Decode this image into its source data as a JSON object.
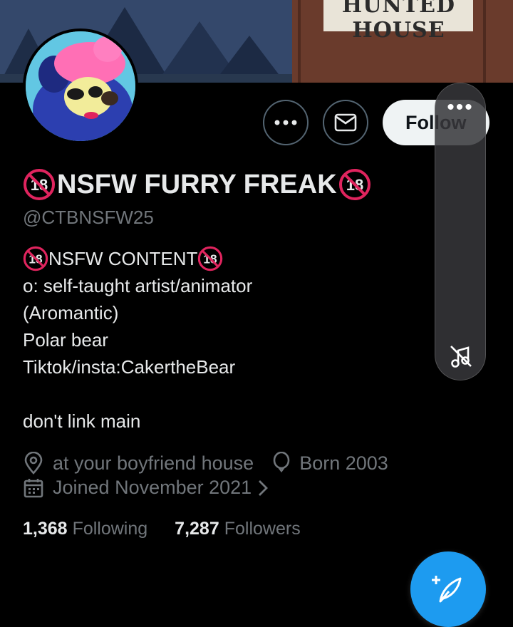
{
  "banner": {
    "sign_text": "HUNTED HOUSE"
  },
  "profile": {
    "display_name": "NSFW FURRY FREAK",
    "handle": "@CTBNSFW25",
    "follow_label": "Follow"
  },
  "bio": {
    "line1": "NSFW CONTENT",
    "line2": "o: self-taught artist/animator",
    "line3": "(Aromantic)",
    "line4": "Polar bear",
    "line5": "Tiktok/insta:CakertheBear",
    "line6": "don't link main"
  },
  "meta": {
    "location": "at your boyfriend house",
    "birthday": "Born 2003",
    "joined": "Joined November 2021"
  },
  "stats": {
    "following_count": "1,368",
    "following_label": "Following",
    "followers_count": "7,287",
    "followers_label": "Followers"
  },
  "overlay": {
    "dots": "•••"
  },
  "colors": {
    "accent": "#1d9bf0",
    "muted": "#71767b",
    "badge_red": "#e0245e"
  },
  "icons": [
    "more-icon",
    "mail-icon",
    "location-icon",
    "birthday-icon",
    "calendar-icon",
    "chevron-right-icon",
    "compose-icon",
    "mute-icon"
  ]
}
